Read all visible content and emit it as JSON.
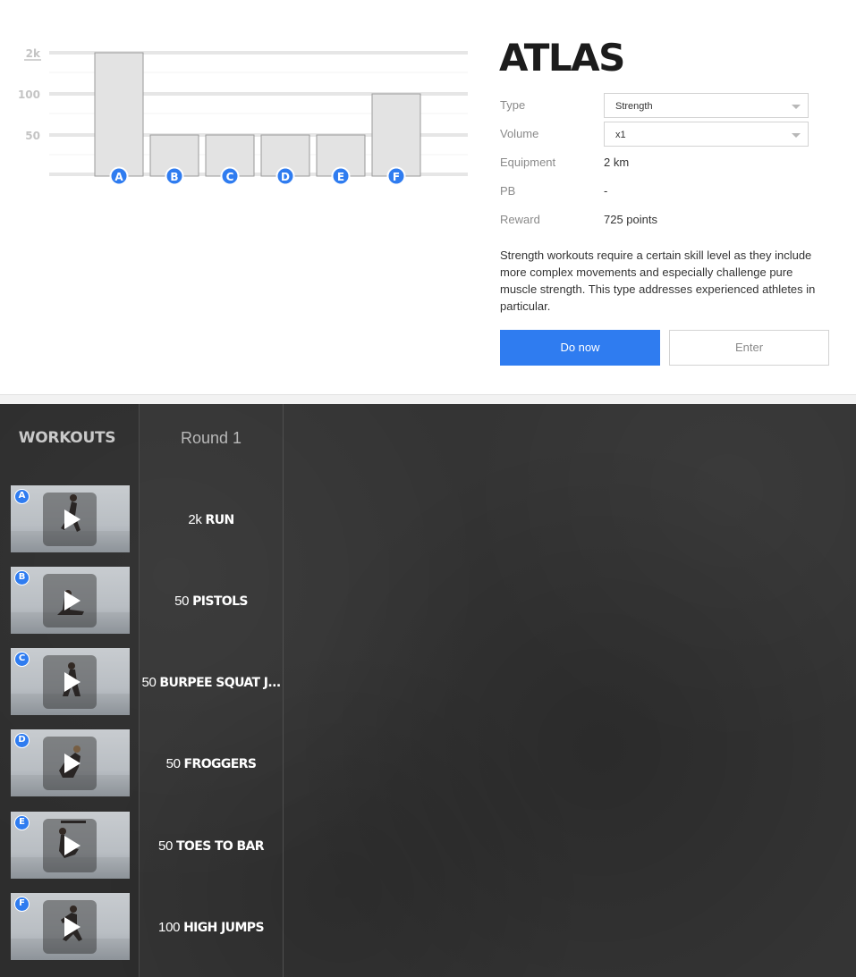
{
  "chart_data": {
    "type": "bar",
    "categories": [
      "A",
      "B",
      "C",
      "D",
      "E",
      "F"
    ],
    "y_tick_labels": [
      "2k",
      "100",
      "50"
    ],
    "values": [
      "2k",
      "50",
      "50",
      "50",
      "50",
      "100"
    ],
    "bar_level": [
      3,
      1,
      1,
      1,
      1,
      2
    ],
    "grid": true
  },
  "workout": {
    "title": "ATLAS",
    "details": [
      {
        "label": "Type",
        "value": "Strength",
        "kind": "select"
      },
      {
        "label": "Volume",
        "value": "x1",
        "kind": "select"
      },
      {
        "label": "Equipment",
        "value": "2 km",
        "kind": "text"
      },
      {
        "label": "PB",
        "value": "-",
        "kind": "text"
      },
      {
        "label": "Reward",
        "value": "725 points",
        "kind": "text"
      }
    ],
    "description": "Strength workouts require a certain skill level as they include more complex movements and especially challenge pure muscle strength. This type addresses experienced athletes in particular.",
    "buttons": {
      "primary": "Do now",
      "secondary": "Enter"
    }
  },
  "panel": {
    "workouts_heading": "WORKOUTS",
    "round_heading": "Round 1",
    "exercises": [
      {
        "letter": "A",
        "qty": "2k",
        "name": "RUN"
      },
      {
        "letter": "B",
        "qty": "50",
        "name": "PISTOLS"
      },
      {
        "letter": "C",
        "qty": "50",
        "name": "BURPEE SQUAT J..."
      },
      {
        "letter": "D",
        "qty": "50",
        "name": "FROGGERS"
      },
      {
        "letter": "E",
        "qty": "50",
        "name": "TOES TO BAR"
      },
      {
        "letter": "F",
        "qty": "100",
        "name": "HIGH JUMPS"
      }
    ]
  },
  "colors": {
    "accent": "#2f7cf0",
    "bar_fill": "#e3e3e3",
    "dark_bg": "#343434"
  },
  "icons": {
    "play": "play-icon",
    "letter_badge": "letter-badge-icon",
    "dropdown": "chevron-down-icon"
  }
}
